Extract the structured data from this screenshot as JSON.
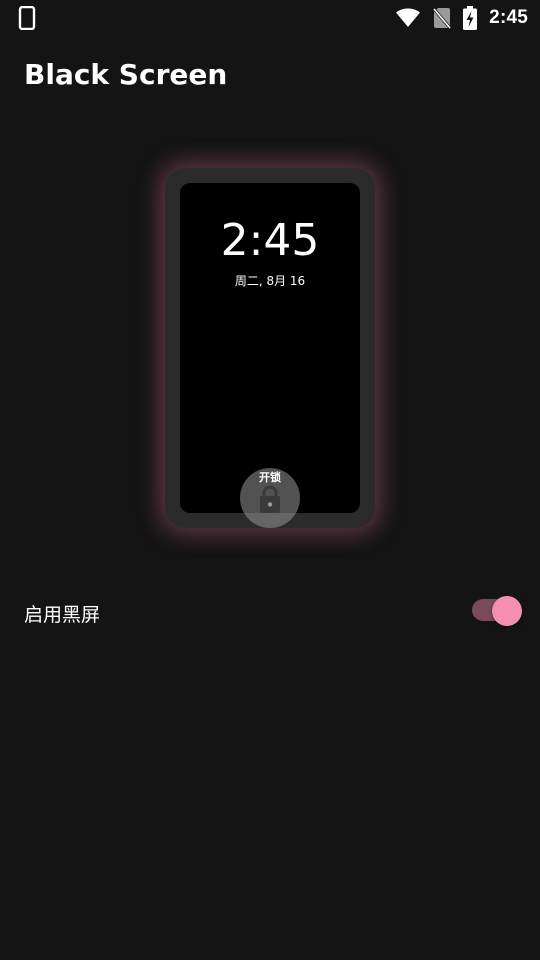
{
  "status_bar": {
    "time": "2:45",
    "left_icon": "phone-icon",
    "right_icons": [
      "wifi-icon",
      "no-sim-icon",
      "battery-charging-icon"
    ]
  },
  "header": {
    "title": "Black Screen"
  },
  "preview": {
    "clock": "2:45",
    "date": "周二, 8月 16",
    "unlock_label": "开锁",
    "unlock_icon": "lock-icon",
    "glow_color": "#ba6082"
  },
  "settings": {
    "enable_label": "启用黑屏",
    "enable_toggle_on": true,
    "toggle_accent": "#f48fb1"
  }
}
